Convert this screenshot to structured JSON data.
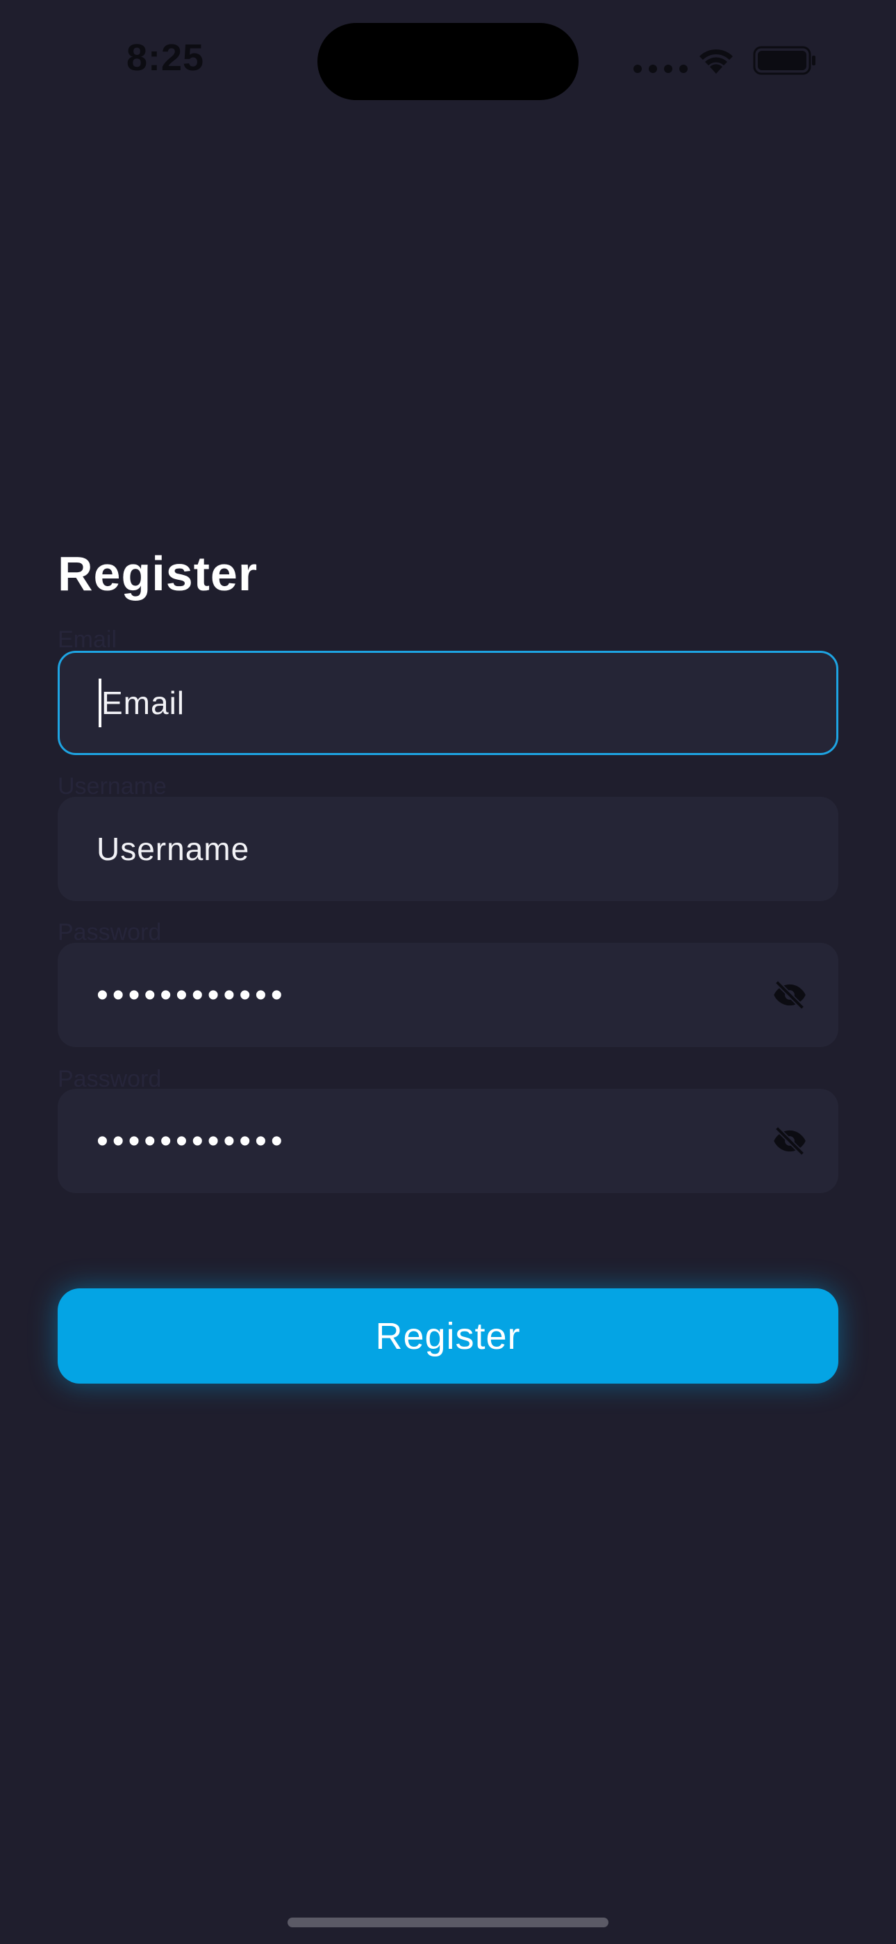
{
  "status_bar": {
    "time": "8:25"
  },
  "page": {
    "title": "Register"
  },
  "form": {
    "email": {
      "label": "Email",
      "placeholder": "Email",
      "value": ""
    },
    "username": {
      "label": "Username",
      "placeholder": "Username",
      "value": ""
    },
    "password": {
      "label": "Password",
      "masked_value": "••••••••••••",
      "visibility_icon": "eye-off-icon"
    },
    "confirm_password": {
      "label": "Password",
      "masked_value": "••••••••••••",
      "visibility_icon": "eye-off-icon"
    },
    "submit_label": "Register"
  },
  "colors": {
    "background": "#1f1e2d",
    "field_background": "#252536",
    "accent": "#04a4e4",
    "focus_border": "#1ea4e2"
  },
  "icons": {
    "wifi": "wifi-icon",
    "battery": "battery-icon",
    "password_toggle": "eye-off-icon"
  }
}
